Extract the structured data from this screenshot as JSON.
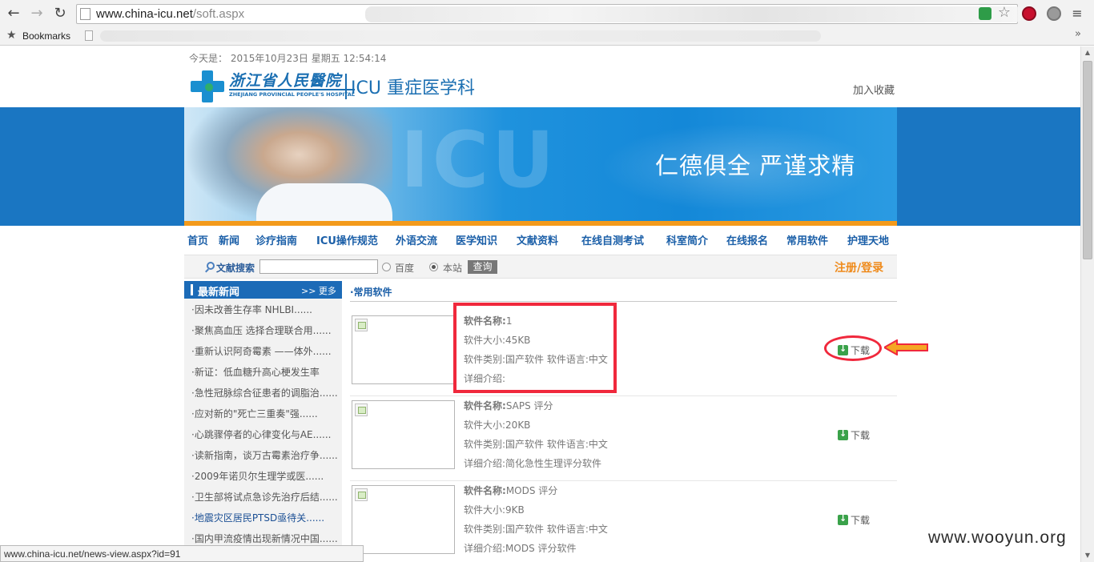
{
  "browser": {
    "url_host": "www.china-icu.net",
    "url_path": "/soft.aspx",
    "bookmarks_label": "Bookmarks",
    "more_symbol": "»"
  },
  "header": {
    "date_text": "今天是： 2015年10月23日 星期五 12:54:14",
    "logo_cn": "浙江省人民醫院",
    "logo_en": "ZHEJIANG PROVINCIAL PEOPLE'S HOSPITAL",
    "dept": "ICU 重症医学科",
    "favorite": "加入收藏"
  },
  "banner": {
    "slogan": "仁德俱全 严谨求精"
  },
  "nav": [
    {
      "label": "首页"
    },
    {
      "label": "新闻"
    },
    {
      "label": "诊疗指南"
    },
    {
      "label": "ICU操作规范"
    },
    {
      "label": "外语交流"
    },
    {
      "label": "医学知识"
    },
    {
      "label": "文献资料"
    },
    {
      "label": "在线自测考试"
    },
    {
      "label": "科室简介"
    },
    {
      "label": "在线报名"
    },
    {
      "label": "常用软件"
    },
    {
      "label": "护理天地"
    }
  ],
  "search": {
    "label": "文献搜索",
    "value": "",
    "option_baidu": "百度",
    "option_site": "本站",
    "selected": "本站",
    "button": "查询",
    "register_login": "注册/登录"
  },
  "news": {
    "title": "最新新闻",
    "more": ">> 更多",
    "items": [
      "·因未改善生存率 NHLBI......",
      "·聚焦高血压 选择合理联合用......",
      "·重新认识阿奇霉素 ——体外......",
      "·新证：低血糖升高心梗发生率",
      "·急性冠脉综合征患者的调脂治......",
      "·应对新的\"死亡三重奏\"强......",
      "·心跳骤停者的心律变化与AE......",
      "·读新指南，谈万古霉素治疗争......",
      "·2009年诺贝尔生理学或医......",
      "·卫生部将试点急诊先治疗后结......",
      "·地震灾区居民PTSD亟待关......",
      "·国内甲流疫情出现新情况中国......"
    ]
  },
  "software": {
    "section_title": "·常用软件",
    "name_label": "软件名称:",
    "download_label": "下载",
    "items": [
      {
        "name": "1",
        "size": "软件大小:45KB",
        "type_lang": "软件类别:国产软件 软件语言:中文",
        "detail": "详细介绍:"
      },
      {
        "name": "SAPS 评分",
        "size": "软件大小:20KB",
        "type_lang": "软件类别:国产软件 软件语言:中文",
        "detail": "详细介绍:简化急性生理评分软件"
      },
      {
        "name": "MODS 评分",
        "size": "软件大小:9KB",
        "type_lang": "软件类别:国产软件 软件语言:中文",
        "detail": "详细介绍:MODS 评分软件"
      }
    ]
  },
  "status_url": "www.china-icu.net/news-view.aspx?id=91",
  "watermark": "www.wooyun.org",
  "colors": {
    "nav_blue": "#1b5fa8",
    "accent_orange": "#ef8a1a",
    "highlight_red": "#f0283c",
    "download_green": "#3aa24a"
  }
}
